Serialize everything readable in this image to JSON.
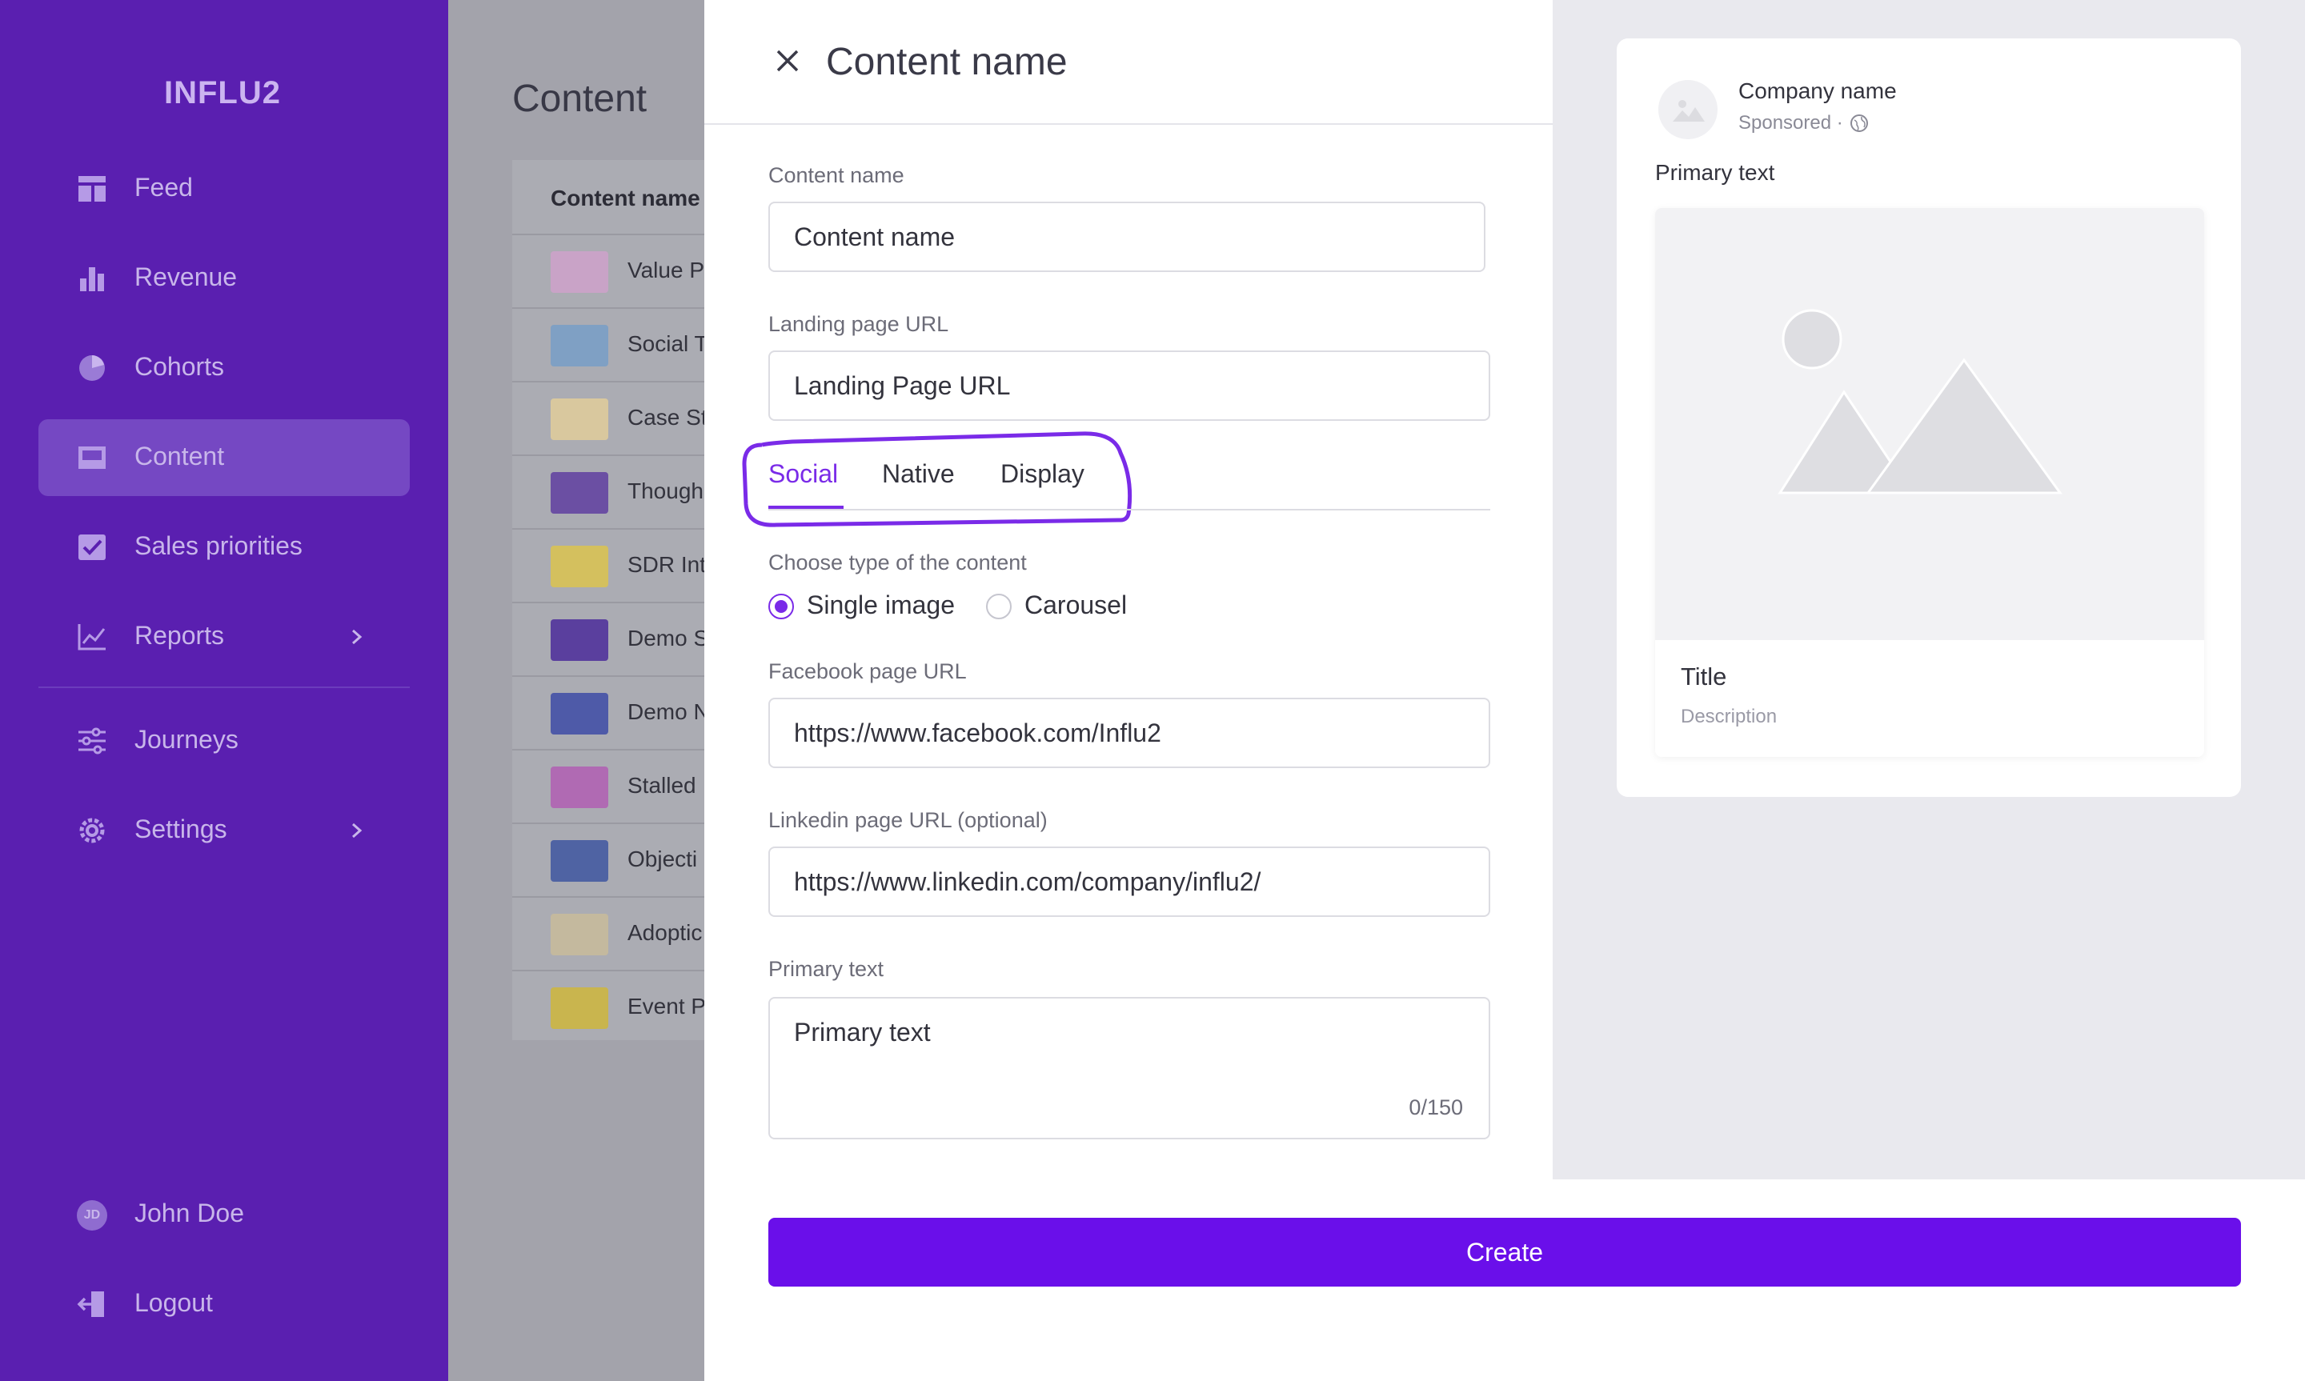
{
  "sidebar": {
    "logo": "INFLU2",
    "items": [
      {
        "label": "Feed",
        "icon": "feed-icon"
      },
      {
        "label": "Revenue",
        "icon": "bar-chart-icon"
      },
      {
        "label": "Cohorts",
        "icon": "pie-chart-icon"
      },
      {
        "label": "Content",
        "icon": "content-icon",
        "active": true
      },
      {
        "label": "Sales priorities",
        "icon": "checkbox-icon"
      },
      {
        "label": "Reports",
        "icon": "line-chart-icon",
        "has_submenu": true
      },
      {
        "label": "Journeys",
        "icon": "sliders-icon"
      },
      {
        "label": "Settings",
        "icon": "gear-icon",
        "has_submenu": true
      }
    ],
    "user": {
      "initials": "JD",
      "name": "John Doe"
    },
    "logout": "Logout"
  },
  "content_page": {
    "title": "Content",
    "column_header": "Content name",
    "rows": [
      "Value P",
      "Social T",
      "Case St",
      "Though",
      "SDR Int",
      "Demo S",
      "Demo N",
      "Stalled",
      "Objecti",
      "Adoptic",
      "Event P"
    ]
  },
  "drawer": {
    "title": "Content name",
    "content_name": {
      "label": "Content name",
      "placeholder": "Content name"
    },
    "landing_url": {
      "label": "Landing page URL",
      "placeholder": "Landing Page URL"
    },
    "tabs": [
      "Social",
      "Native",
      "Display"
    ],
    "active_tab": "Social",
    "content_type": {
      "label": "Choose type of the content",
      "options": [
        "Single image",
        "Carousel"
      ],
      "selected": "Single image"
    },
    "facebook_url": {
      "label": "Facebook page URL",
      "value": "https://www.facebook.com/Influ2"
    },
    "linkedin_url": {
      "label": "Linkedin page URL (optional)",
      "value": "https://www.linkedin.com/company/influ2/"
    },
    "primary_text": {
      "label": "Primary text",
      "placeholder": "Primary text",
      "counter": "0/150"
    },
    "create_label": "Create"
  },
  "preview": {
    "company": "Company name",
    "sponsored": "Sponsored ·",
    "primary_text": "Primary text",
    "title": "Title",
    "description": "Description"
  },
  "colors": {
    "sidebar": "#5a1fb0",
    "accent": "#7a2be8",
    "button": "#6a0fea"
  }
}
